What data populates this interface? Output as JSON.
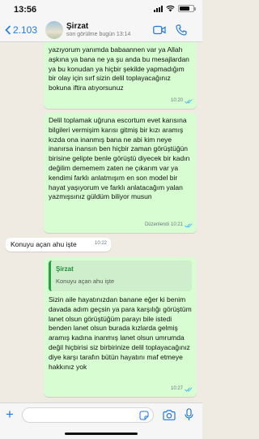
{
  "status_bar": {
    "time": "13:56"
  },
  "header": {
    "back_count": "2.103",
    "contact_name": "Şirzat",
    "last_seen": "son görülme bugün 13:14"
  },
  "messages": [
    {
      "kind": "sent",
      "text": "yazıyorum yanımda babaannen var ya Allah aşkına ya bana ne ya şu anda bu mesajlardan ya bu konudan ya hiçbir şekilde yapmadığım bir olay için sırf sizin delil toplayacağınız bokuna iftira atıyorsunuz",
      "time": "10:20",
      "status": "read"
    },
    {
      "kind": "sent",
      "text": "Delil toplamak uğruna escortum evet karısına bilgileri vermişim karısı gitmiş bir kızı aramış kızda ona inanmış bana ne abi kim neye inanırsa inansın ben hiçbir zaman görüştüğün birisine gelipte benle görüştü diyecek bir kadın değilim dememem zaten ne çıkarım var ya kendimi farklı anlatmışım en son model bir hayat yaşıyorum ve farklı anlatacağım yalan yazmışsınız güldüm biliyor musun",
      "edited_label": "Düzenlendi",
      "time": "10:21",
      "status": "read"
    },
    {
      "kind": "received",
      "text": "Konuyu açan ahu işte",
      "time": "10:22"
    },
    {
      "kind": "sent",
      "quote": {
        "author": "Şirzat",
        "text": "Konuyu açan ahu işte"
      },
      "text": "Sizin aile hayatınızdan banane eğer ki benim davada adım geçsin ya para karşılığı görüştüm  lanet olsun görüştüğüm parayı bile istedi benden lanet olsun burada kızlarda gelmiş aramış kadına inanmış lanet olsun umrumda değil hiçbirisi siz birbirinize delil toplayacağınız diye karşı tarafın bütün hayatını maf etmeye hakkınız yok",
      "time": "10:27",
      "status": "read"
    }
  ],
  "icons": {
    "back": "chevron-left-icon",
    "video": "video-call-icon",
    "call": "phone-icon",
    "attach": "plus-icon",
    "sticker": "sticker-icon",
    "camera": "camera-icon",
    "mic": "microphone-icon"
  },
  "colors": {
    "accent": "#1f7ae0",
    "sent_bubble": "#d9fdd3",
    "received_bubble": "#ffffff",
    "read_ticks": "#53bdeb",
    "chat_background": "#efeae2"
  }
}
